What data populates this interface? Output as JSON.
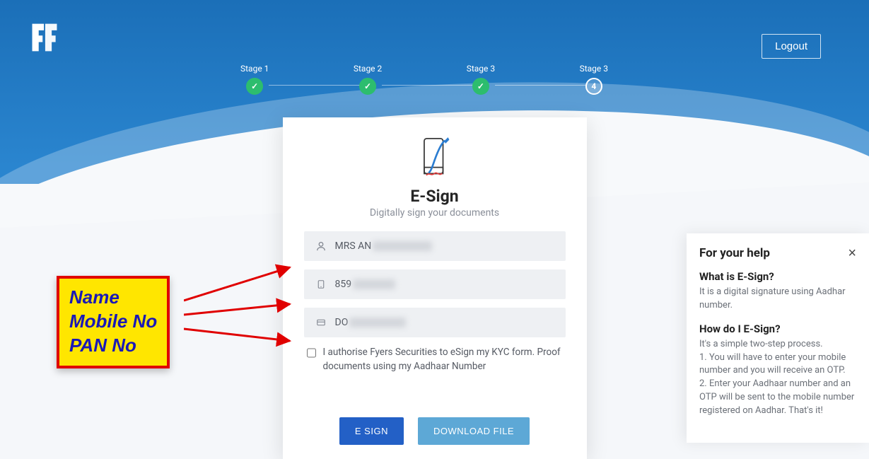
{
  "header": {
    "logout": "Logout"
  },
  "stepper": {
    "steps": [
      {
        "label": "Stage 1",
        "done": true,
        "mark": "✓"
      },
      {
        "label": "Stage 2",
        "done": true,
        "mark": "✓"
      },
      {
        "label": "Stage 3",
        "done": true,
        "mark": "✓"
      },
      {
        "label": "Stage 3",
        "done": false,
        "mark": "4"
      }
    ]
  },
  "card": {
    "title": "E-Sign",
    "subtitle": "Digitally sign your documents",
    "fields": {
      "name_prefix": "MRS AN",
      "mobile_prefix": "859",
      "pan_prefix": "DO"
    },
    "authorise": "I authorise Fyers Securities to eSign my KYC form. Proof documents using my Aadhaar Number",
    "buttons": {
      "esign": "E SIGN",
      "download": "DOWNLOAD FILE"
    }
  },
  "annotation": {
    "line1": "Name",
    "line2": "Mobile No",
    "line3": "PAN No"
  },
  "help": {
    "title": "For your help",
    "close": "×",
    "q1": "What is E-Sign?",
    "a1": "It is a digital signature using Aadhar number.",
    "q2": "How do I E-Sign?",
    "a2": "It's a simple two-step process.\n1. You will have to enter your mobile number and you will receive an OTP.\n2. Enter your Aadhaar number and an OTP will be sent to the mobile number registered on Aadhar. That's it!"
  }
}
